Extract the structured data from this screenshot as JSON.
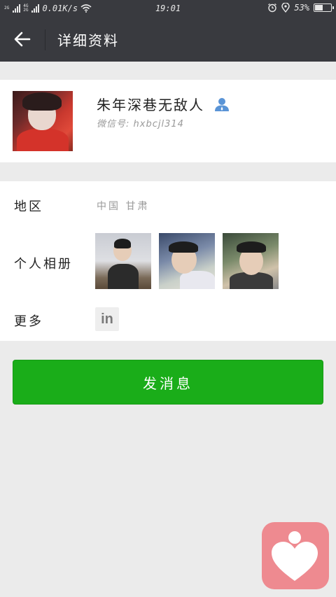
{
  "status_bar": {
    "signal_1": "2G",
    "signal_2_top": "4G",
    "signal_2_bottom": "2G",
    "speed": "0.01K/s",
    "time": "19:01",
    "battery_percent": "53%",
    "battery_level": 0.53
  },
  "header": {
    "title": "详细资料",
    "back_icon": "arrow-left-icon"
  },
  "profile": {
    "nickname": "朱年深巷无敌人",
    "wechat_id": "微信号: hxbcjl314",
    "contact_icon": "contact-person-icon"
  },
  "details": {
    "region_label": "地区",
    "region_value": "中国  甘肃",
    "album_label": "个人相册",
    "more_label": "更多",
    "more_icon": "linkedin-icon",
    "more_icon_text": "in"
  },
  "actions": {
    "send_message_label": "发消息"
  },
  "colors": {
    "header_bg": "#393a3f",
    "page_bg": "#ebebeb",
    "primary_green": "#1aad19",
    "float_app_bg": "#ee8a90"
  }
}
